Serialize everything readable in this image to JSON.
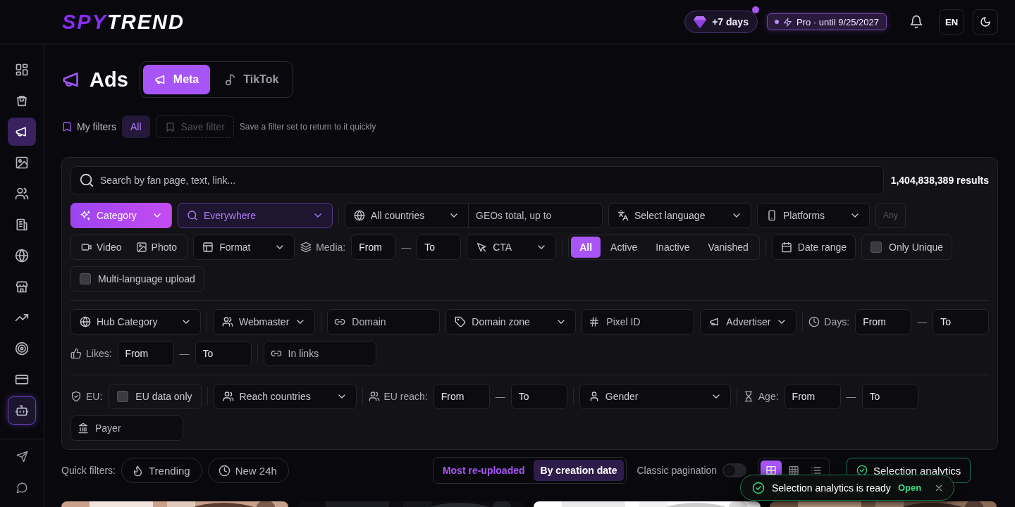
{
  "brand": {
    "logo_accent": "SPY",
    "logo_rest": "TREND"
  },
  "header": {
    "bonus": {
      "label": "+7 days",
      "unread": true
    },
    "plan": "Pro · until 9/25/2027",
    "language": "EN"
  },
  "sidebar": {
    "items": [
      {
        "selected": false,
        "highlighted": false
      },
      {
        "selected": false,
        "highlighted": false
      },
      {
        "selected": true,
        "highlighted": false
      },
      {
        "selected": false,
        "highlighted": false
      },
      {
        "selected": false,
        "highlighted": false
      },
      {
        "selected": false,
        "highlighted": false
      },
      {
        "selected": false,
        "highlighted": false
      },
      {
        "selected": false,
        "highlighted": false
      },
      {
        "selected": false,
        "highlighted": false
      },
      {
        "selected": false,
        "highlighted": false
      },
      {
        "selected": false,
        "highlighted": false
      },
      {
        "selected": false,
        "highlighted": true
      }
    ],
    "bottom_items": [
      {
        "selected": false
      },
      {
        "selected": false
      }
    ]
  },
  "page": {
    "title": "Ads",
    "tabs": [
      {
        "label": "Meta",
        "selected": true
      },
      {
        "label": "TikTok",
        "selected": false
      }
    ]
  },
  "my_filters": {
    "label": "My filters",
    "chips": [
      {
        "label": "All",
        "selected": true
      }
    ],
    "save_button": {
      "label": "Save filter",
      "disabled": true
    },
    "hint": "Save a filter set to return to it quickly"
  },
  "search": {
    "placeholder": "Search by fan page, text, link...",
    "results": "1,404,838,389 results"
  },
  "filter_sections": [
    {
      "rows": [
        {
          "groups": [
            [
              {
                "kind": "dropdown",
                "label": "Category"
              },
              {
                "kind": "dropdown",
                "label": "Everywhere"
              }
            ],
            [
              {
                "kind": "combo",
                "label": "All countries",
                "placeholder": "GEOs total, up to"
              },
              {
                "kind": "dropdown",
                "label": "Select language"
              },
              {
                "kind": "dropdown",
                "label": "Platforms"
              },
              {
                "kind": "button",
                "label": "Any",
                "disabled": true
              }
            ]
          ]
        },
        {
          "groups": [
            [
              {
                "kind": "options",
                "options": [
                  {
                    "label": "Video",
                    "selected": false
                  },
                  {
                    "label": "Photo",
                    "selected": false
                  }
                ]
              },
              {
                "kind": "dropdown",
                "label": "Format"
              },
              {
                "kind": "range",
                "label": "Media:",
                "from": {
                  "placeholder": "From"
                },
                "dash": "—",
                "to": {
                  "placeholder": "To"
                }
              },
              {
                "kind": "dropdown",
                "label": "CTA"
              }
            ],
            [
              {
                "kind": "segmented",
                "options": [
                  {
                    "label": "All",
                    "selected": true
                  },
                  {
                    "label": "Active",
                    "selected": false
                  },
                  {
                    "label": "Inactive",
                    "selected": false
                  },
                  {
                    "label": "Vanished",
                    "selected": false
                  }
                ]
              }
            ],
            [
              {
                "kind": "button",
                "label": "Date range",
                "disabled": false
              },
              {
                "kind": "checkbox",
                "label": "Only Unique",
                "checked": false
              }
            ]
          ]
        },
        {
          "groups": [
            [
              {
                "kind": "checkbox",
                "label": "Multi-language upload",
                "checked": false
              }
            ]
          ]
        }
      ]
    },
    {
      "rows": [
        {
          "groups": [
            [
              {
                "kind": "dropdown",
                "label": "Hub Category"
              }
            ],
            [
              {
                "kind": "dropdown",
                "label": "Webmaster"
              }
            ],
            [
              {
                "kind": "field",
                "placeholder": "Domain"
              },
              {
                "kind": "dropdown",
                "label": "Domain zone"
              },
              {
                "kind": "field",
                "placeholder": "Pixel ID"
              },
              {
                "kind": "dropdown",
                "label": "Advertiser"
              }
            ],
            [
              {
                "kind": "range",
                "label": "Days:",
                "from": {
                  "placeholder": "From"
                },
                "dash": "—",
                "to": {
                  "placeholder": "To"
                }
              }
            ]
          ]
        },
        {
          "groups": [
            [
              {
                "kind": "range",
                "label": "Likes:",
                "from": {
                  "placeholder": "From"
                },
                "dash": "—",
                "to": {
                  "placeholder": "To"
                }
              }
            ],
            [
              {
                "kind": "field",
                "placeholder": "In links"
              }
            ]
          ]
        }
      ]
    },
    {
      "rows": [
        {
          "groups": [
            [
              {
                "kind": "label",
                "text": "EU:"
              },
              {
                "kind": "checkbox",
                "label": "EU data only",
                "checked": false
              }
            ],
            [
              {
                "kind": "dropdown",
                "label": "Reach countries"
              }
            ],
            [
              {
                "kind": "range",
                "label": "EU reach:",
                "from": {
                  "placeholder": "From"
                },
                "dash": "—",
                "to": {
                  "placeholder": "To"
                }
              }
            ],
            [
              {
                "kind": "dropdown",
                "label": "Gender"
              }
            ],
            [
              {
                "kind": "range",
                "label": "Age:",
                "from": {
                  "placeholder": "From"
                },
                "dash": "—",
                "to": {
                  "placeholder": "To"
                }
              }
            ]
          ]
        },
        {
          "groups": [
            [
              {
                "kind": "field",
                "placeholder": "Payer"
              }
            ]
          ]
        }
      ]
    }
  ],
  "results_bar": {
    "label": "Quick filters:",
    "quick": [
      {
        "label": "Trending"
      },
      {
        "label": "New 24h"
      }
    ],
    "sort": [
      {
        "label": "Most re-uploaded",
        "selected": false
      },
      {
        "label": "By creation date",
        "selected": true
      }
    ],
    "pagination": {
      "label": "Classic pagination",
      "on": false
    },
    "views": [
      {
        "selected": true
      },
      {
        "selected": false
      },
      {
        "selected": false
      }
    ],
    "analytics_button": "Selection analytics"
  },
  "toast": {
    "message": "Selection analytics is ready",
    "action": "Open"
  }
}
